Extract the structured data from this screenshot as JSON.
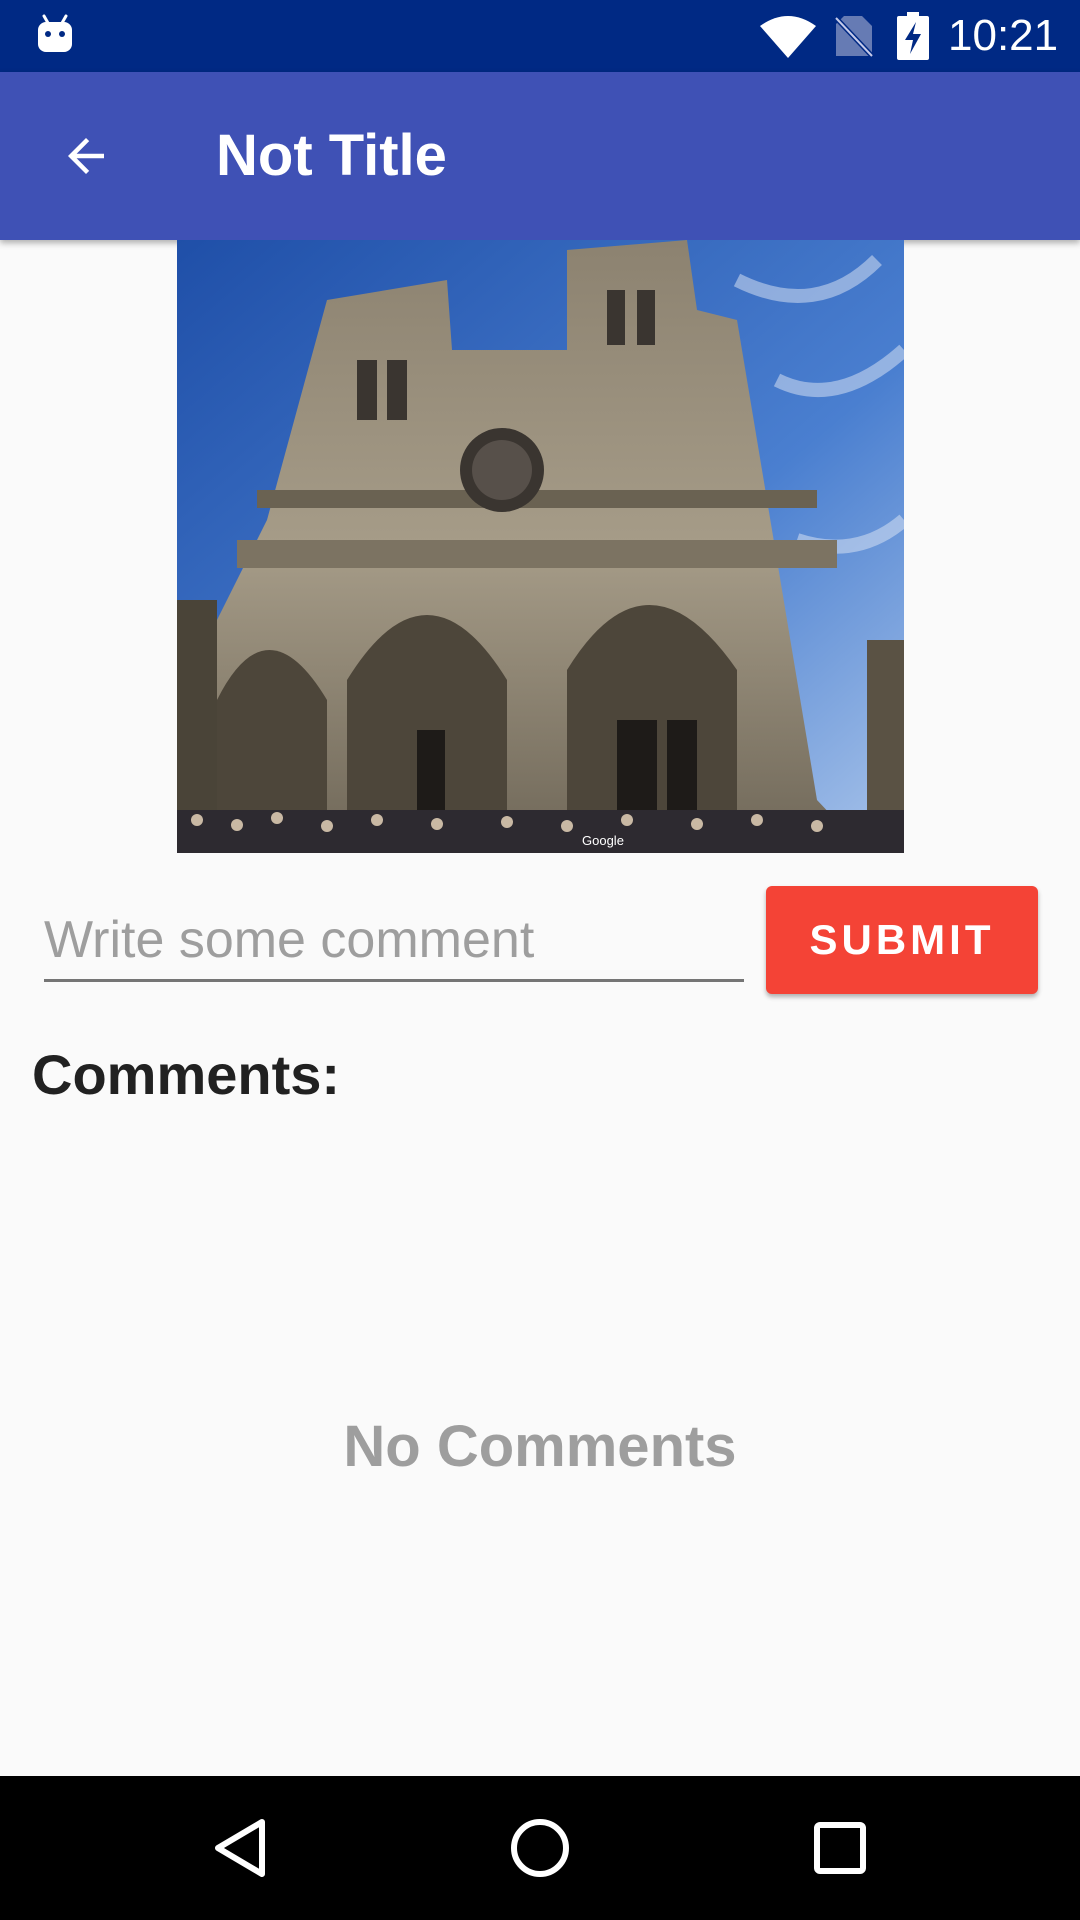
{
  "status_bar": {
    "time": "10:21",
    "icons": [
      "android-notification-icon",
      "wifi-icon",
      "no-sim-icon",
      "battery-charging-icon"
    ]
  },
  "app_bar": {
    "title": "Not Title",
    "back_icon": "arrow-back-icon"
  },
  "photo": {
    "subject": "cathedral-facade-photo",
    "watermark": "Google"
  },
  "comment_form": {
    "placeholder": "Write some comment",
    "value": "",
    "submit_label": "SUBMIT"
  },
  "comments": {
    "heading": "Comments:",
    "empty_text": "No Comments"
  },
  "nav_bar": {
    "buttons": [
      "back-triangle-icon",
      "home-circle-icon",
      "recents-square-icon"
    ]
  },
  "colors": {
    "status_bar": "#002984",
    "app_bar": "#3f51b5",
    "submit": "#f44336",
    "background": "#fafafa"
  }
}
